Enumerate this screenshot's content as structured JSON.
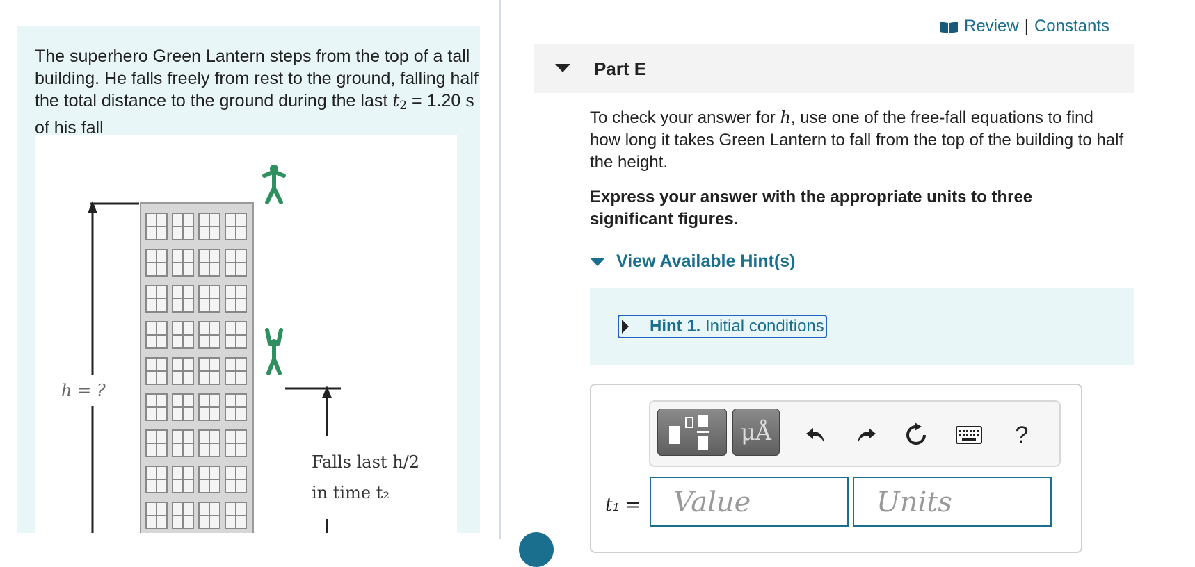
{
  "problem": {
    "text_before": "The superhero Green Lantern steps from the top of a tall building. He falls freely from rest to the ground, falling half the total distance to the ground during the last ",
    "t_symbol": "t",
    "t_subscript": "2",
    "equals_value": " = 1.20 ",
    "unit": "s",
    "text_after": " of his fall"
  },
  "figure": {
    "h_label": "h = ?",
    "falls_line1": "Falls last h/2",
    "falls_line2": "in time t₂"
  },
  "header_links": {
    "review": "Review",
    "separator": "|",
    "constants": "Constants"
  },
  "part": {
    "title": "Part E"
  },
  "instructions": {
    "before": "To check your answer for ",
    "symbol": "h",
    "after": ", use one of the free-fall equations to find how long it takes Green Lantern to fall from the top of the building to half the height."
  },
  "express": "Express your answer with the appropriate units to three significant figures.",
  "hints": {
    "toggle_label": "View Available Hint(s)",
    "hint1_number": "Hint 1.",
    "hint1_title": "Initial conditions"
  },
  "toolbar": {
    "units_label": "μÅ",
    "help_label": "?"
  },
  "answer": {
    "label": "t₁ =",
    "value_placeholder": "Value",
    "units_placeholder": "Units"
  },
  "colors": {
    "accent": "#1a6f8f",
    "panel_bg": "#e8f6f7",
    "figure_green": "#2f8f5f"
  }
}
